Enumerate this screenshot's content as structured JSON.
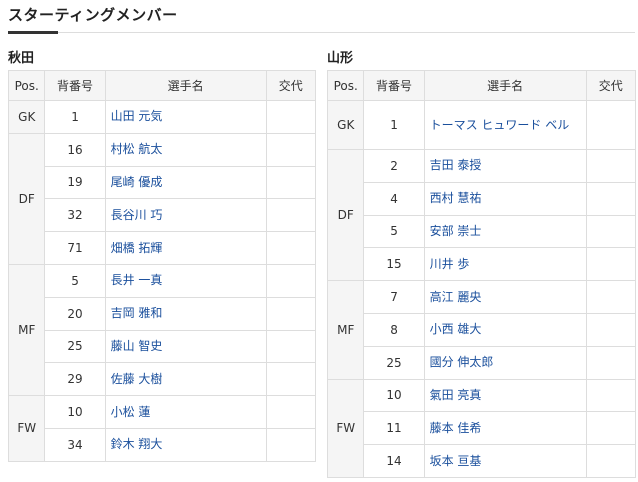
{
  "page_title": "スターティングメンバー",
  "columns": {
    "pos": "Pos.",
    "number": "背番号",
    "player": "選手名",
    "sub": "交代"
  },
  "teams": [
    {
      "name": "秋田",
      "groups": [
        {
          "pos": "GK",
          "players": [
            {
              "number": "1",
              "name": "山田 元気"
            }
          ]
        },
        {
          "pos": "DF",
          "players": [
            {
              "number": "16",
              "name": "村松 航太"
            },
            {
              "number": "19",
              "name": "尾崎 優成"
            },
            {
              "number": "32",
              "name": "長谷川 巧"
            },
            {
              "number": "71",
              "name": "畑橋 拓輝"
            }
          ]
        },
        {
          "pos": "MF",
          "players": [
            {
              "number": "5",
              "name": "長井 一真"
            },
            {
              "number": "20",
              "name": "吉岡 雅和"
            },
            {
              "number": "25",
              "name": "藤山 智史"
            },
            {
              "number": "29",
              "name": "佐藤 大樹"
            }
          ]
        },
        {
          "pos": "FW",
          "players": [
            {
              "number": "10",
              "name": "小松 蓮"
            },
            {
              "number": "34",
              "name": "鈴木 翔大"
            }
          ]
        }
      ]
    },
    {
      "name": "山形",
      "groups": [
        {
          "pos": "GK",
          "players": [
            {
              "number": "1",
              "name": "トーマス ヒュワード ベル"
            }
          ]
        },
        {
          "pos": "DF",
          "players": [
            {
              "number": "2",
              "name": "吉田 泰授"
            },
            {
              "number": "4",
              "name": "西村 慧祐"
            },
            {
              "number": "5",
              "name": "安部 崇士"
            },
            {
              "number": "15",
              "name": "川井 歩"
            }
          ]
        },
        {
          "pos": "MF",
          "players": [
            {
              "number": "7",
              "name": "高江 麗央"
            },
            {
              "number": "8",
              "name": "小西 雄大"
            },
            {
              "number": "25",
              "name": "國分 伸太郎"
            }
          ]
        },
        {
          "pos": "FW",
          "players": [
            {
              "number": "10",
              "name": "氣田 亮真"
            },
            {
              "number": "11",
              "name": "藤本 佳希"
            },
            {
              "number": "14",
              "name": "坂本 亘基"
            }
          ]
        }
      ]
    }
  ]
}
